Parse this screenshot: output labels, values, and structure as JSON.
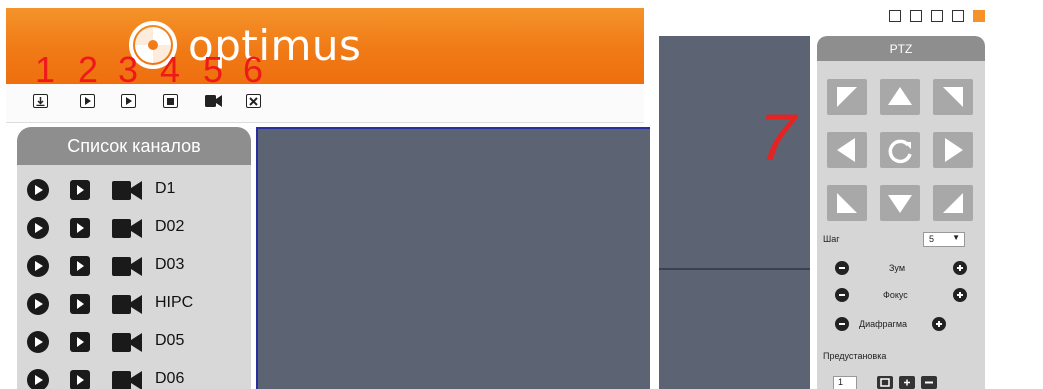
{
  "brand": {
    "name": "optimus"
  },
  "toolbar": {
    "numbers": [
      "1",
      "2",
      "3",
      "4",
      "5",
      "6"
    ],
    "buttons": [
      "download-icon",
      "play-icon",
      "play-icon",
      "stop-icon",
      "camera-icon",
      "close-icon"
    ]
  },
  "channel_list": {
    "title": "Список каналов",
    "channels": [
      {
        "label": "D1"
      },
      {
        "label": "D02"
      },
      {
        "label": "D03"
      },
      {
        "label": "HIPC"
      },
      {
        "label": "D05"
      },
      {
        "label": "D06"
      }
    ]
  },
  "annotation": {
    "ptz_number": "7"
  },
  "ptz": {
    "title": "PTZ",
    "step_label": "Шаг",
    "step_value": "5",
    "zoom_label": "Зум",
    "focus_label": "Фокус",
    "iris_label": "Диафрагма",
    "preset_label": "Предустановка",
    "preset_value": "1"
  },
  "colors": {
    "brand": "#f07a16",
    "video": "#5c6474",
    "annotation": "#ee1a1a"
  }
}
